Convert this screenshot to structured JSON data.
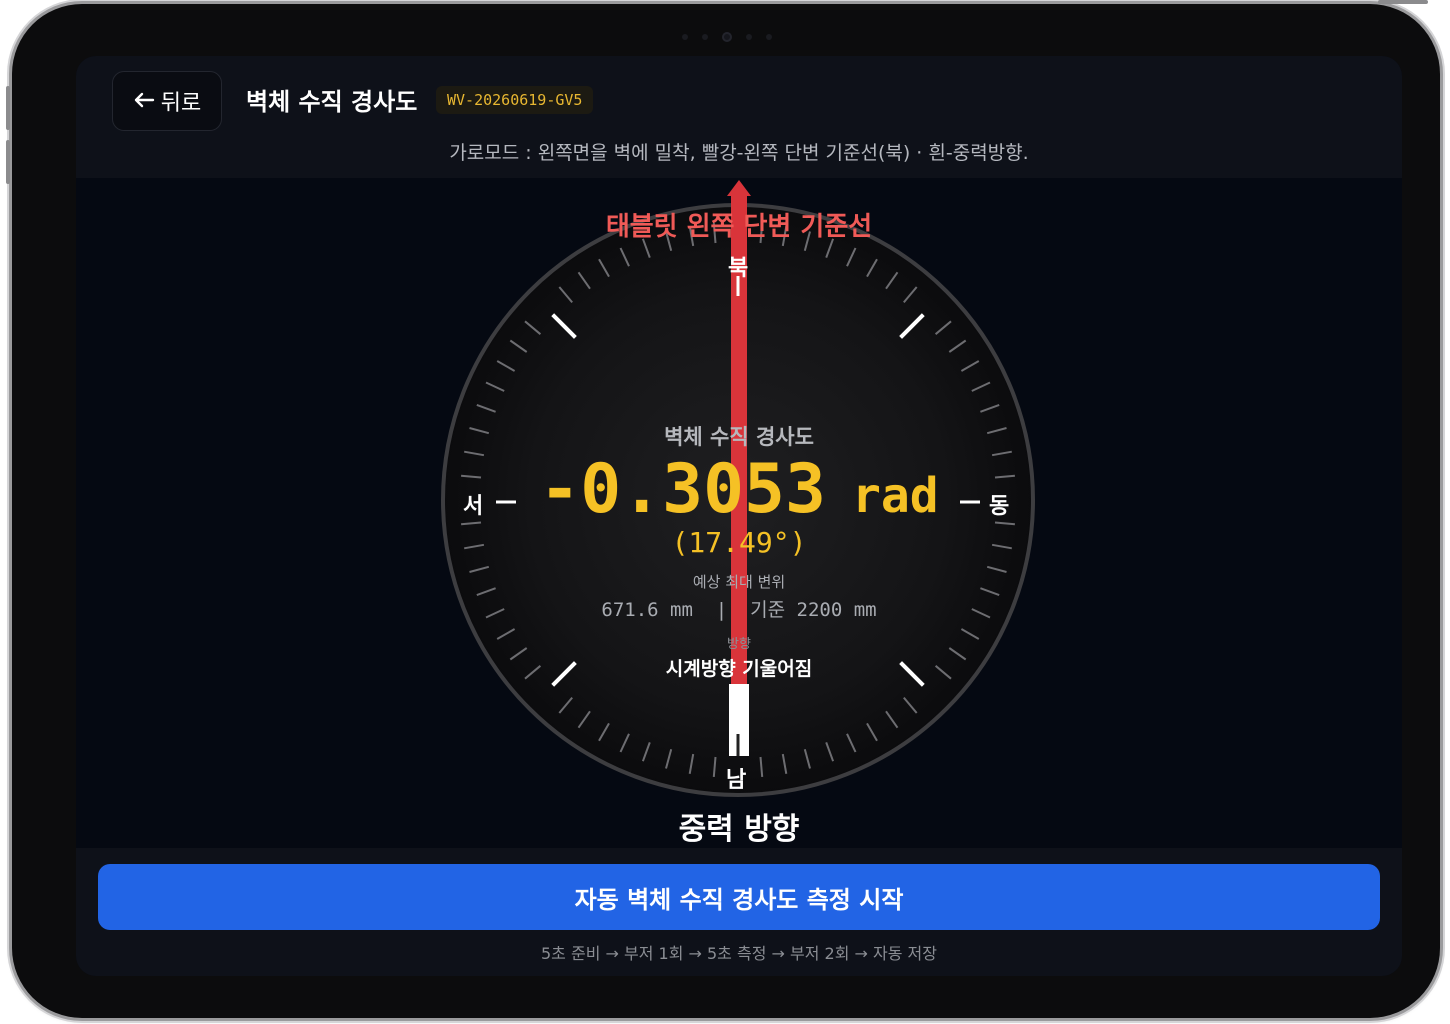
{
  "header": {
    "back_label": "뒤로",
    "back_icon": "arrow-left-icon",
    "title": "벽체 수직 경사도",
    "device_id": "WV-20260619-GV5",
    "instruction": "가로모드 : 왼쪽면을 벽에 밀착, 빨강-왼쪽 단변 기준선(북) · 흰-중력방향."
  },
  "dial": {
    "reference_label": "태블릿 왼쪽 단변 기준선",
    "gravity_label": "중력 방향",
    "cardinals": {
      "north": "북",
      "south": "남",
      "east": "동",
      "west": "서"
    },
    "reference_color": "#e53935",
    "gravity_color": "#ffffff"
  },
  "reading": {
    "title": "벽체 수직 경사도",
    "value": "-0.3053",
    "unit": "rad",
    "degrees_text": "(17.49°)",
    "value_color": "#f5c125",
    "displacement_label": "예상 최대 변위",
    "displacement_value": "671.6 mm  |  기준 2200 mm",
    "direction_label": "방향",
    "direction_value": "시계방향 기울어짐"
  },
  "footer": {
    "start_button": "자동 벽체 수직 경사도 측정 시작",
    "steps": "5초 준비 → 부저 1회 → 5초 측정 → 부저 2회 → 자동 저장",
    "accent_color": "#2264e5"
  }
}
